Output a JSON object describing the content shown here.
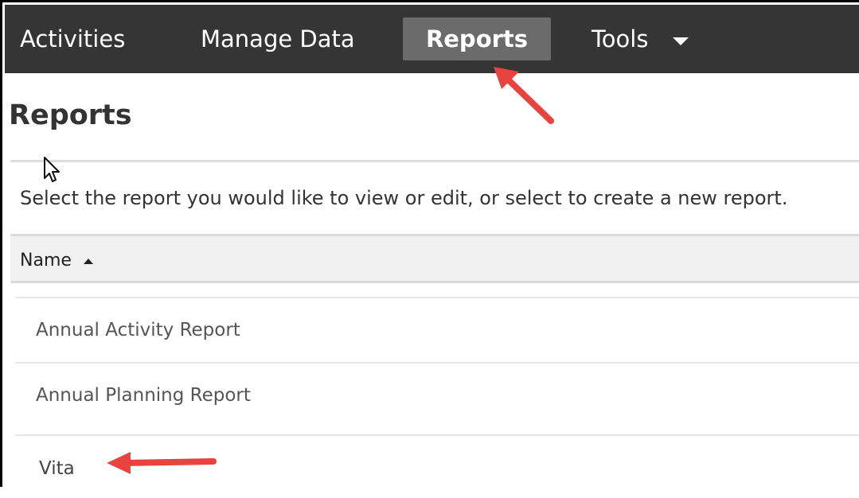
{
  "nav": {
    "items": [
      "Activities",
      "Manage Data",
      "Reports",
      "Tools"
    ],
    "active": "Reports"
  },
  "page": {
    "title": "Reports",
    "description": "Select the report you would like to view or edit, or select to create a new report."
  },
  "table": {
    "column": "Name",
    "sort": "ascending",
    "rows": [
      "Annual Activity Report",
      "Annual Planning Report",
      "Vita"
    ]
  },
  "colors": {
    "navbar": "#353535",
    "active_tab": "#6b6b6b",
    "annotation_arrow": "#e8433f"
  },
  "icons": [
    "caret-down-icon",
    "sort-ascending-icon",
    "mouse-cursor-icon",
    "annotation-arrow"
  ]
}
